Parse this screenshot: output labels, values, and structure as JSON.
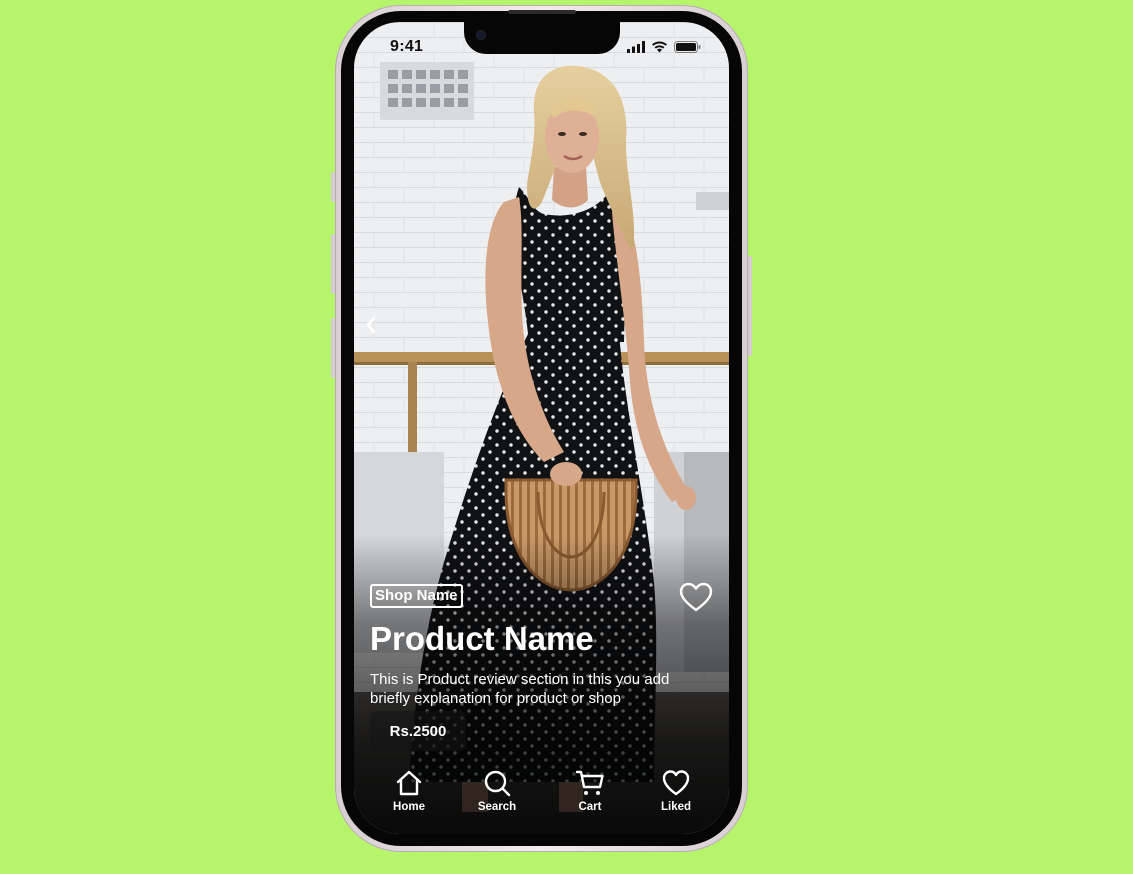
{
  "status_bar": {
    "time": "9:41",
    "icons": [
      "cellular-signal-icon",
      "wifi-icon",
      "battery-icon"
    ]
  },
  "product": {
    "shop_name": "Shop Name",
    "title": "Product Name",
    "description": "This is Product review section in this you add briefly explanation for product or shop",
    "price": "Rs.2500",
    "liked": false
  },
  "nav": {
    "back_icon": "chevron-left-icon",
    "like_icon": "heart-outline-icon"
  },
  "tabbar": {
    "items": [
      {
        "label": "Home",
        "icon": "home-icon"
      },
      {
        "label": "Search",
        "icon": "search-icon"
      },
      {
        "label": "Cart",
        "icon": "cart-icon"
      },
      {
        "label": "Liked",
        "icon": "heart-icon"
      }
    ]
  },
  "colors": {
    "background": "#b5f46b",
    "text_on_image": "#ffffff",
    "phone_frame": "#e9e1e4"
  }
}
